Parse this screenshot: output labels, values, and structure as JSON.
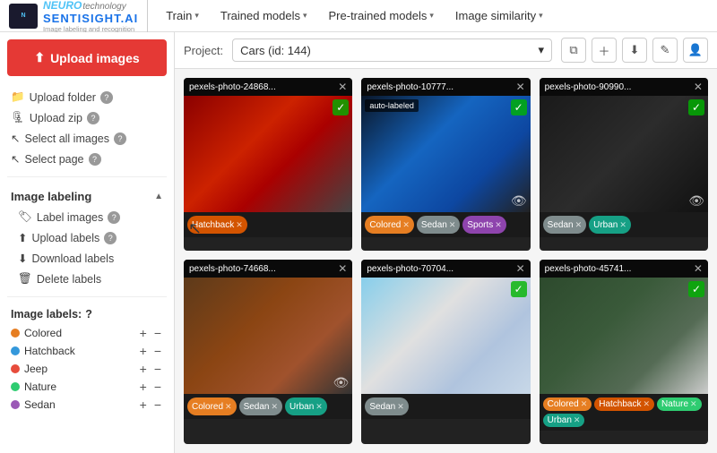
{
  "header": {
    "logo_brand": "NEURO",
    "logo_technology": "technology",
    "logo_name": "SENTISIGHT.AI",
    "logo_sub": "Image labeling and recognition",
    "nav": [
      {
        "label": "Train",
        "has_arrow": true
      },
      {
        "label": "Trained models",
        "has_arrow": true
      },
      {
        "label": "Pre-trained models",
        "has_arrow": true
      },
      {
        "label": "Image similarity",
        "has_arrow": true
      }
    ]
  },
  "sidebar": {
    "upload_button": "Upload images",
    "items": [
      {
        "icon": "folder-icon",
        "label": "Upload folder",
        "has_info": true
      },
      {
        "icon": "zip-icon",
        "label": "Upload zip",
        "has_info": true
      },
      {
        "icon": "select-icon",
        "label": "Select all images",
        "has_info": true
      },
      {
        "icon": "page-icon",
        "label": "Select page",
        "has_info": true
      }
    ],
    "labeling_section": "Image labeling",
    "labeling_items": [
      {
        "label": "Label images",
        "has_info": true
      },
      {
        "label": "Upload labels",
        "has_info": true
      },
      {
        "label": "Download labels"
      },
      {
        "label": "Delete labels"
      }
    ],
    "image_labels_title": "Image labels:",
    "labels": [
      {
        "name": "Colored",
        "color": "#e67e22"
      },
      {
        "name": "Hatchback",
        "color": "#3498db"
      },
      {
        "name": "Jeep",
        "color": "#e74c3c"
      },
      {
        "name": "Nature",
        "color": "#2ecc71"
      },
      {
        "name": "Sedan",
        "color": "#9b59b6"
      }
    ]
  },
  "project_bar": {
    "label": "Project:",
    "selected": "Cars (id: 144)",
    "actions": [
      "copy-icon",
      "add-icon",
      "download-icon",
      "edit-icon",
      "user-icon"
    ]
  },
  "images": [
    {
      "id": "pexels-photo-24868...",
      "style": "car1",
      "has_check": true,
      "tags": [
        {
          "label": "Hatchback",
          "cls": "tag-hatchback"
        }
      ]
    },
    {
      "id": "pexels-photo-10777...",
      "style": "car2",
      "has_check": true,
      "auto_label": true,
      "has_eye": true,
      "tags": [
        {
          "label": "Colored",
          "cls": "tag-colored"
        },
        {
          "label": "Sedan",
          "cls": "tag-sedan"
        },
        {
          "label": "Sports",
          "cls": "tag-sports"
        }
      ]
    },
    {
      "id": "pexels-photo-90990...",
      "style": "car3",
      "has_check": true,
      "has_eye": true,
      "tags": [
        {
          "label": "Sedan",
          "cls": "tag-sedan"
        },
        {
          "label": "Urban",
          "cls": "tag-urban"
        }
      ]
    },
    {
      "id": "pexels-photo-74668...",
      "style": "car4",
      "has_eye": true,
      "tags": [
        {
          "label": "Colored",
          "cls": "tag-colored"
        },
        {
          "label": "Sedan",
          "cls": "tag-sedan"
        },
        {
          "label": "Urban",
          "cls": "tag-urban"
        }
      ]
    },
    {
      "id": "pexels-photo-70704...",
      "style": "car5",
      "has_check": true,
      "tags": [
        {
          "label": "Sedan",
          "cls": "tag-sedan"
        }
      ]
    },
    {
      "id": "pexels-photo-45741...",
      "style": "car6",
      "has_check": true,
      "tags": [
        {
          "label": "Colored",
          "cls": "tag-colored"
        },
        {
          "label": "Hatchback",
          "cls": "tag-hatchback"
        },
        {
          "label": "Nature",
          "cls": "tag-nature"
        },
        {
          "label": "Urban",
          "cls": "tag-urban"
        }
      ]
    }
  ]
}
